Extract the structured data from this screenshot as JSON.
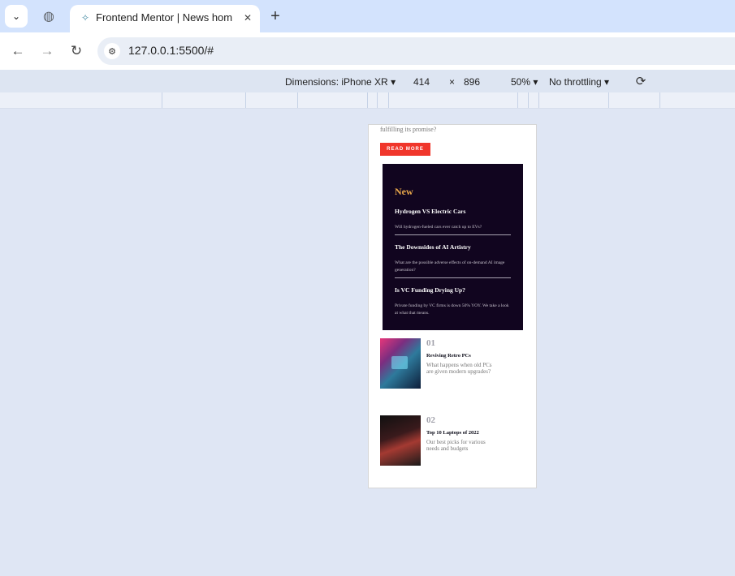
{
  "browser": {
    "tab_title": "Frontend Mentor | News homepage",
    "url": "127.0.0.1:5500/#"
  },
  "devtools": {
    "dimensions_label": "Dimensions: iPhone XR",
    "width": "414",
    "times": "×",
    "height": "896",
    "zoom": "50%",
    "throttling": "No throttling"
  },
  "page": {
    "intro_text": "fulfilling its promise?",
    "read_more": "READ MORE",
    "new_section": {
      "title": "New",
      "items": [
        {
          "title": "Hydrogen VS Electric Cars",
          "desc": "Will hydrogen-fueled cars ever catch up to EVs?"
        },
        {
          "title": "The Downsides of AI Artistry",
          "desc": "What are the possible adverse effects of on-demand AI image generation?"
        },
        {
          "title": "Is VC Funding Drying Up?",
          "desc": "Private funding by VC firms is down 50% YOY. We take a look at what that means."
        }
      ]
    },
    "stories": [
      {
        "number": "01",
        "title": "Reviving Retro PCs",
        "desc": "What happens when old PCs are given modern upgrades?"
      },
      {
        "number": "02",
        "title": "Top 10 Laptops of 2022",
        "desc": "Our best picks for various needs and budgets"
      }
    ]
  },
  "icons": {
    "tab_menu": "chevron-down-icon",
    "globe": "globe-icon",
    "back": "back-arrow-icon",
    "forward": "forward-arrow-icon",
    "reload": "reload-icon",
    "site_info": "tune-icon",
    "rotate": "rotate-icon"
  },
  "colors": {
    "accent_red": "#f0362b",
    "panel_dark": "#11051f",
    "new_title": "#e9a84b"
  }
}
